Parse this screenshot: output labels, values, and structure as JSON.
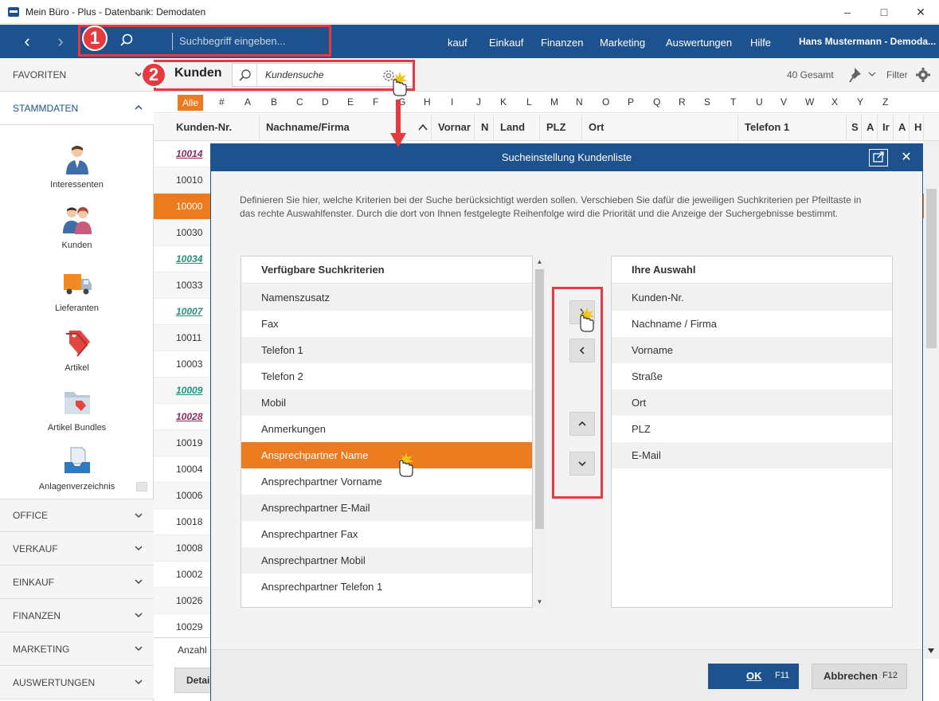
{
  "window": {
    "title": "Mein Büro - Plus - Datenbank: Demodaten"
  },
  "topnav": {
    "search_placeholder": "Suchbegriff eingeben...",
    "menu": [
      "kauf",
      "Einkauf",
      "Finanzen",
      "Marketing",
      "Auswertungen",
      "Hilfe"
    ],
    "user": "Hans Mustermann - Demoda..."
  },
  "annotations": {
    "badge1": "1",
    "badge2": "2"
  },
  "sidebar": {
    "favoriten": "FAVORITEN",
    "stammdaten": "STAMMDATEN",
    "items": [
      "Interessenten",
      "Kunden",
      "Lieferanten",
      "Artikel",
      "Artikel Bundles",
      "Anlagenverzeichnis"
    ],
    "sections": [
      "OFFICE",
      "VERKAUF",
      "EINKAUF",
      "FINANZEN",
      "MARKETING",
      "AUSWERTUNGEN"
    ]
  },
  "toolbar": {
    "title": "Kunden",
    "search_value": "Kundensuche",
    "total": "40 Gesamt",
    "filter": "Filter"
  },
  "alphabet": {
    "all": "Alle",
    "letters": [
      "#",
      "A",
      "B",
      "C",
      "D",
      "E",
      "F",
      "G",
      "H",
      "I",
      "J",
      "K",
      "L",
      "M",
      "N",
      "O",
      "P",
      "Q",
      "R",
      "S",
      "T",
      "U",
      "V",
      "W",
      "X",
      "Y",
      "Z"
    ]
  },
  "table": {
    "columns": [
      "Kunden-Nr.",
      "Nachname/Firma",
      "Vornar",
      "N",
      "Land",
      "PLZ",
      "Ort",
      "Telefon 1",
      "S",
      "A",
      "Ir",
      "A",
      "H"
    ],
    "rows": [
      "10014",
      "10010",
      "10000",
      "10030",
      "10034",
      "10033",
      "10007",
      "10011",
      "10003",
      "10009",
      "10028",
      "10019",
      "10004",
      "10006",
      "10018",
      "10008",
      "10002",
      "10026",
      "10029"
    ],
    "anzahl": "Anzahl",
    "details": "Detai"
  },
  "dialog": {
    "title": "Sucheinstellung Kundenliste",
    "description": "Definieren Sie hier, welche Kriterien bei der Suche berücksichtigt werden sollen. Verschieben Sie dafür die jeweiligen Suchkriterien per Pfeiltaste in das rechte Auswahlfenster. Durch die dort von Ihnen festgelegte Reihenfolge wird die Priorität und die Anzeige der Suchergebnisse bestimmt.",
    "available": {
      "header": "Verfügbare Suchkriterien",
      "items": [
        "Namenszusatz",
        "Fax",
        "Telefon 1",
        "Telefon 2",
        "Mobil",
        "Anmerkungen",
        "Ansprechpartner Name",
        "Ansprechpartner Vorname",
        "Ansprechpartner E-Mail",
        "Ansprechpartner Fax",
        "Ansprechpartner Mobil",
        "Ansprechpartner Telefon 1"
      ],
      "selected": "Ansprechpartner Name"
    },
    "selection": {
      "header": "Ihre Auswahl",
      "items": [
        "Kunden-Nr.",
        "Nachname / Firma",
        "Vorname",
        "Straße",
        "Ort",
        "PLZ",
        "E-Mail"
      ]
    },
    "ok_label": "OK",
    "ok_key": "F11",
    "cancel_label": "Abbrechen",
    "cancel_key": "F12"
  },
  "colors": {
    "brand": "#1d528e",
    "accent": "#ec7a1f",
    "annotation": "#e53a3f"
  }
}
